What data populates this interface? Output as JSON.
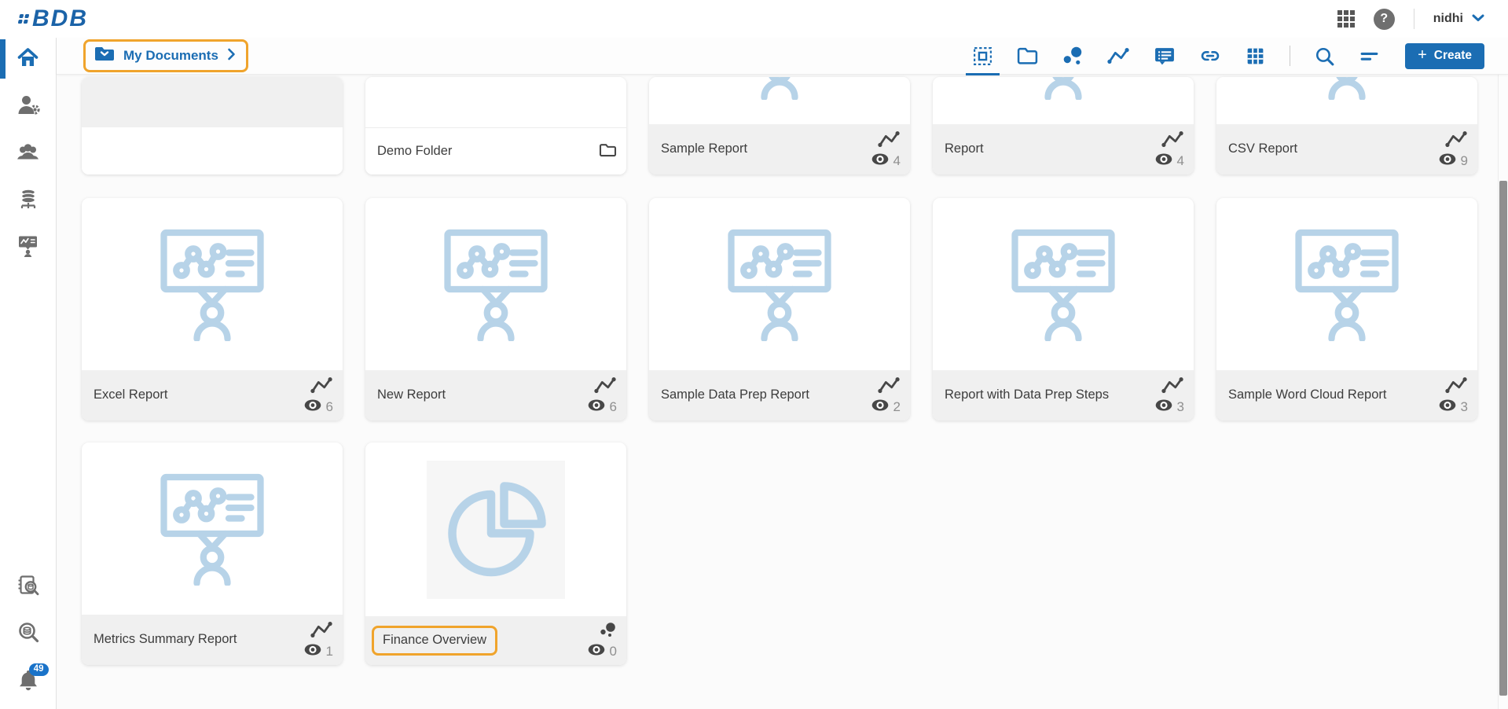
{
  "app": {
    "logo_text": "BDB"
  },
  "header": {
    "user_name": "nidhi",
    "icons": [
      {
        "name": "apps-grid-icon"
      },
      {
        "name": "help-icon"
      },
      {
        "name": "user-chevron-down-icon"
      }
    ]
  },
  "breadcrumb": {
    "label": "My Documents",
    "annotated": true
  },
  "toolbar": {
    "create_plus": "+",
    "create_label": "Create",
    "icons": [
      {
        "name": "select-view-icon",
        "active": true
      },
      {
        "name": "folder-view-icon",
        "active": false
      },
      {
        "name": "scatter-view-icon",
        "active": false
      },
      {
        "name": "trend-view-icon",
        "active": false
      },
      {
        "name": "board-view-icon",
        "active": false
      },
      {
        "name": "link-view-icon",
        "active": false
      },
      {
        "name": "grid-view-icon",
        "active": false
      },
      {
        "name": "divider",
        "active": false
      },
      {
        "name": "search-icon",
        "active": false
      },
      {
        "name": "sort-icon",
        "active": false
      }
    ]
  },
  "sidebar": {
    "top_items": [
      {
        "name": "home",
        "active": true
      },
      {
        "name": "user-admin",
        "active": false
      },
      {
        "name": "user-groups",
        "active": false
      },
      {
        "name": "data-center",
        "active": false
      },
      {
        "name": "presentation",
        "active": false
      }
    ],
    "bottom_items": [
      {
        "name": "data-catalog",
        "active": false
      },
      {
        "name": "data-search",
        "active": false
      },
      {
        "name": "notifications",
        "active": false,
        "badge": "49"
      }
    ]
  },
  "cards": {
    "rows": [
      {
        "items": [
          {
            "label": "",
            "variant": "gray-empty",
            "footer": "white",
            "footer_icon": null,
            "views": null,
            "annotated": false
          },
          {
            "label": "Demo Folder",
            "variant": "folder",
            "footer": "white-divider",
            "footer_icon": "folder-icon",
            "views": null,
            "annotated": false
          },
          {
            "label": "Sample Report",
            "variant": "report-cut",
            "footer": "gray",
            "footer_icon": "trend-icon",
            "views": "4",
            "annotated": false
          },
          {
            "label": "Report",
            "variant": "report-cut",
            "footer": "gray",
            "footer_icon": "trend-icon",
            "views": "4",
            "annotated": false
          },
          {
            "label": "CSV Report",
            "variant": "report-cut",
            "footer": "gray",
            "footer_icon": "trend-icon",
            "views": "9",
            "annotated": false
          }
        ]
      },
      {
        "items": [
          {
            "label": "Excel Report",
            "variant": "report",
            "footer": "gray",
            "footer_icon": "trend-icon",
            "views": "6",
            "annotated": false
          },
          {
            "label": "New Report",
            "variant": "report",
            "footer": "gray",
            "footer_icon": "trend-icon",
            "views": "6",
            "annotated": false
          },
          {
            "label": "Sample Data Prep Report",
            "variant": "report",
            "footer": "gray",
            "footer_icon": "trend-icon",
            "views": "2",
            "annotated": false
          },
          {
            "label": "Report with Data Prep Steps",
            "variant": "report",
            "footer": "gray",
            "footer_icon": "trend-icon",
            "views": "3",
            "annotated": false
          },
          {
            "label": "Sample Word Cloud Report",
            "variant": "report",
            "footer": "gray",
            "footer_icon": "trend-icon",
            "views": "3",
            "annotated": false
          }
        ]
      },
      {
        "items": [
          {
            "label": "Metrics Summary Report",
            "variant": "report",
            "footer": "gray",
            "footer_icon": "trend-icon",
            "views": "1",
            "annotated": false
          },
          {
            "label": "Finance Overview",
            "variant": "pie",
            "footer": "gray",
            "footer_icon": "scatter-icon",
            "views": "0",
            "annotated": true
          }
        ]
      }
    ]
  },
  "colors": {
    "brand_blue": "#1b6db3",
    "light_blue": "#b7d3e8",
    "annotation_orange": "#f0a42c",
    "badge_blue": "#1a73c9",
    "footer_gray": "#f0f0f0"
  }
}
